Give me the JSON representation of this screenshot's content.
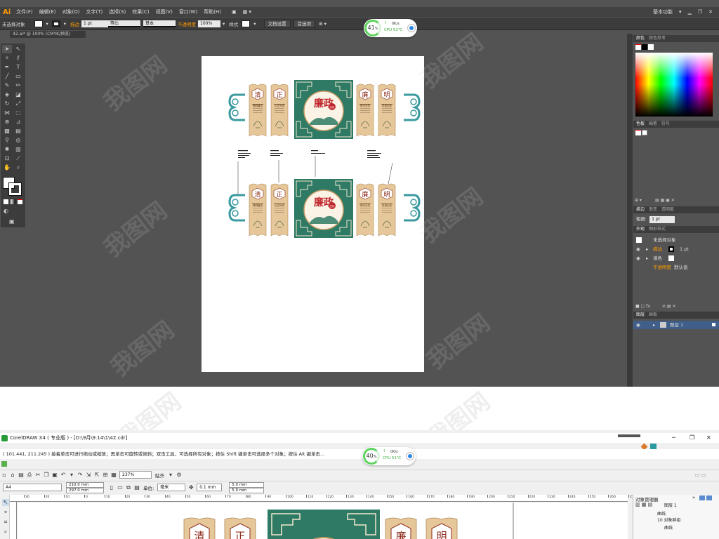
{
  "illustrator": {
    "logo": "Ai",
    "menus": [
      "文件(F)",
      "编辑(E)",
      "对象(O)",
      "文字(T)",
      "选择(S)",
      "效果(C)",
      "视图(V)",
      "窗口(W)",
      "帮助(H)"
    ],
    "workspace": "基本功能",
    "control_bar": {
      "selection": "未选择对象",
      "stroke_label": "描边",
      "stroke_value": "1 pt",
      "profile_label": "等比",
      "brush_label": "基本",
      "opacity_label": "不透明度",
      "opacity_value": "100%",
      "style_label": "样式",
      "doc_setup": "文档设置",
      "preferences": "首选项"
    },
    "doc_tab": "42.ai* @ 100% (CMYK/预览)",
    "cpu": {
      "percent": "41",
      "unit": "%",
      "speed": "0K/s",
      "label": "CPU 51℃"
    },
    "panels": {
      "color_tabs": [
        "颜色",
        "颜色参考"
      ],
      "swatch_tabs": [
        "色板",
        "画笔",
        "符号"
      ],
      "stroke_tabs": [
        "描边",
        "渐变",
        "透明度"
      ],
      "stroke_weight_label": "粗细",
      "stroke_weight_value": "1 pt",
      "appearance_tabs": [
        "外观",
        "图形样式"
      ],
      "appearance_title": "未选择对象",
      "appearance_rows": [
        {
          "label": "描边",
          "value": "1 pt"
        },
        {
          "label": "填色",
          "value": ""
        },
        {
          "label": "不透明度",
          "value": "默认值"
        }
      ],
      "layers_tabs": [
        "图层",
        "画板"
      ],
      "layer_name": "图层 1"
    },
    "artwork": {
      "panel_chars": [
        "清",
        "正",
        "廉",
        "明"
      ],
      "center_title": "廉政",
      "center_subtitle": "文化",
      "captions": [
        "清明廉洁",
        "公正为本",
        "修行为先",
        "忠诚为民"
      ]
    }
  },
  "coreldraw": {
    "title": "CorelDRAW X4 ( 专业版 ) - [D:\\9月\\9.14\\1\\42.cdr]",
    "status": "( 101.441, 211.245 )   接着单击可进行拖动或缩放；再单击可旋转或倾斜；双击工具，可选择所有对象；按住 Shift 键单击可选择多个对象；按住 Alt 键单击...",
    "cpu": {
      "percent": "40",
      "unit": "%",
      "speed": "0K/s",
      "label": "CPU 51℃"
    },
    "zoom": "237%",
    "snap_label": "贴齐",
    "page_size": "A4",
    "width": "210.0 mm",
    "height": "297.0 mm",
    "units_label": "单位:",
    "units_value": "毫米",
    "nudge": "0.1 mm",
    "dup_x": "5.0 mm",
    "dup_y": "5.0 mm",
    "ruler_labels": [
      "30",
      "20",
      "10",
      "0",
      "10",
      "20",
      "30",
      "40",
      "50",
      "60",
      "70",
      "80",
      "90",
      "100",
      "110",
      "120",
      "130",
      "140",
      "150",
      "160",
      "170",
      "180",
      "190",
      "200",
      "210",
      "220",
      "230",
      "240",
      "250",
      "260",
      "270",
      "280"
    ],
    "obj_manager": {
      "title": "对象管理器",
      "items": [
        "图层 1",
        "曲线",
        "10 对象群组",
        "曲线"
      ]
    },
    "artwork_chars": [
      "清",
      "正",
      "廉",
      "明"
    ]
  },
  "watermark": "我图网"
}
